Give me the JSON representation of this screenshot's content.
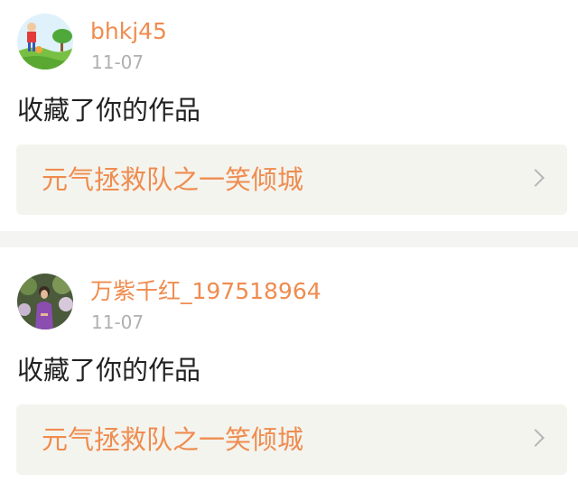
{
  "notifications": [
    {
      "user": "bhkj45",
      "date": "11-07",
      "action": "收藏了你的作品",
      "work_title": "元气拯救队之一笑倾城"
    },
    {
      "user": "万紫千红_197518964",
      "date": "11-07",
      "action": "收藏了你的作品",
      "work_title": "元气拯救队之一笑倾城"
    }
  ],
  "colors": {
    "accent": "#ef8c4f",
    "muted": "#b0b0b0",
    "link_background": "#f4f4ef",
    "separator": "#f4f4f2"
  }
}
